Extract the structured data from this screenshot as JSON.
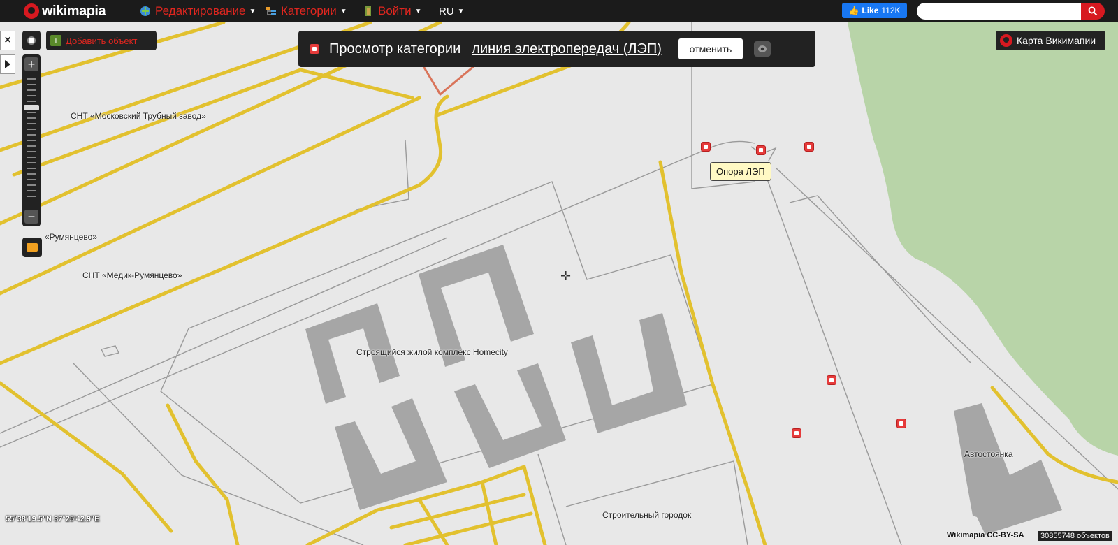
{
  "topbar": {
    "logo_text": "wikimapia",
    "menu": [
      {
        "label": "Редактирование",
        "icon": "edit-globe-icon"
      },
      {
        "label": "Категории",
        "icon": "categories-icon"
      },
      {
        "label": "Войти",
        "icon": "login-door-icon"
      },
      {
        "label": "RU",
        "icon": "language-icon"
      }
    ],
    "fb_like_label": "Like",
    "fb_like_count": "112K",
    "search_placeholder": "",
    "search_value": ""
  },
  "controls": {
    "close_label": "×",
    "add_object_label": "Добавить объект",
    "zoom_in_label": "+",
    "zoom_out_label": "−",
    "map_switch_label": "Карта Викимапии"
  },
  "banner": {
    "prefix": "Просмотр категории",
    "category_link": "линия электропередач (ЛЭП)",
    "cancel_label": "отменить"
  },
  "tooltip": {
    "text": "Опора ЛЭП"
  },
  "map_labels": {
    "snt_trubny": "СНТ «Московский Трубный завод»",
    "rumyantsevo": "«Румянцево»",
    "snt_medik": "СНТ «Медик-Румянцево»",
    "homecity": "Строящийся жилой комплекс Homecity",
    "autostoyanka": "Автостоянка",
    "stroitelny": "Строительный городок"
  },
  "footer": {
    "coords": "55°38'19.5\"N 37°25'42.9\"E",
    "copyright": "Wikimapia CC-BY-SA",
    "object_count": "30855748 объектов"
  },
  "colors": {
    "topbar_bg": "#1b1b1b",
    "brand_red": "#d71920",
    "map_bg": "#e8e8e8",
    "road_yellow": "#f5d93c",
    "forest_green": "#b8d4a8",
    "building_gray": "#a6a6a6",
    "tooltip_bg": "#fff9c4"
  }
}
